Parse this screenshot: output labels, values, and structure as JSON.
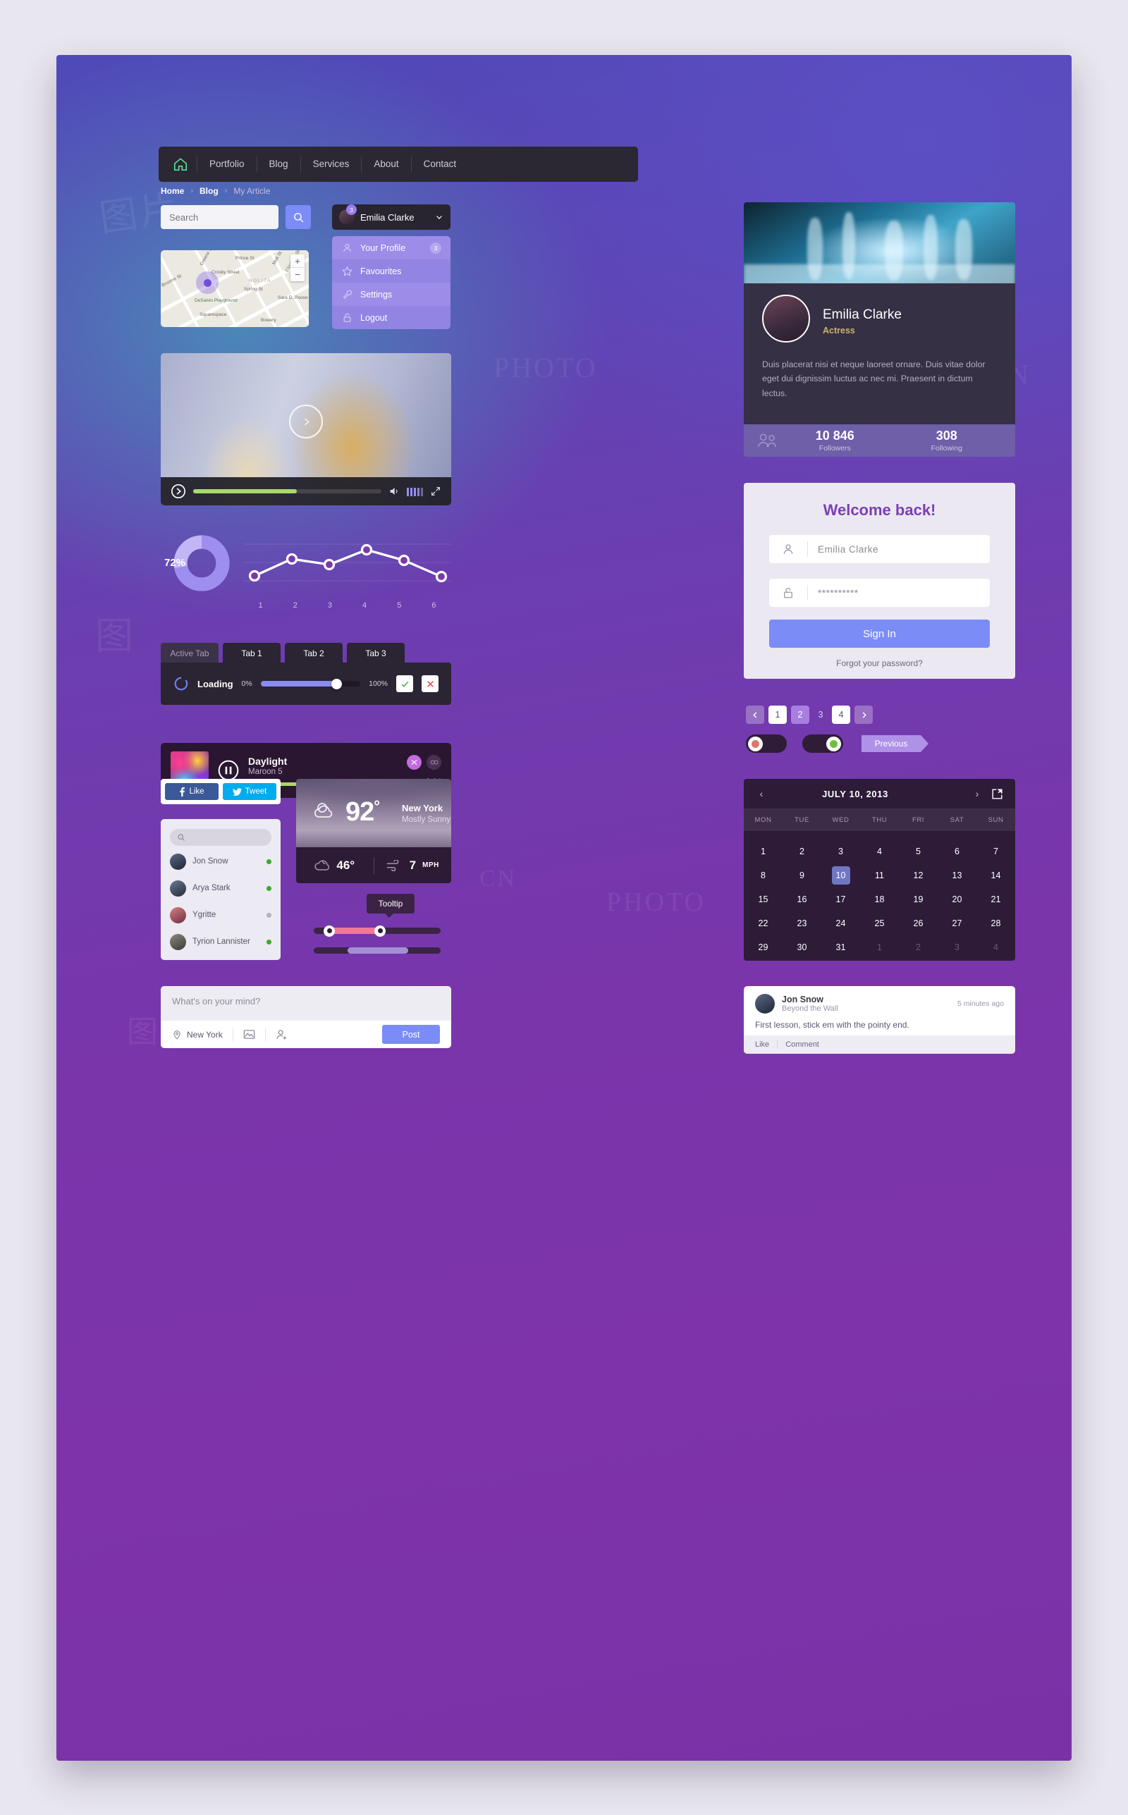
{
  "nav": {
    "home_icon": "home-icon",
    "items": [
      "Portfolio",
      "Blog",
      "Services",
      "About",
      "Contact"
    ]
  },
  "breadcrumb": {
    "items": [
      "Home",
      "Blog",
      "My Article"
    ],
    "separator": "›"
  },
  "search": {
    "placeholder": "Search",
    "value": "",
    "icon": "search-icon"
  },
  "user_pill": {
    "name": "Emilia Clarke",
    "badge": "3",
    "chevron": "chevron-down-icon"
  },
  "dropdown": {
    "items": [
      {
        "label": "Your Profile",
        "icon": "user-icon",
        "count": "3"
      },
      {
        "label": "Favourites",
        "icon": "star-icon",
        "count": ""
      },
      {
        "label": "Settings",
        "icon": "wrench-icon",
        "count": ""
      },
      {
        "label": "Logout",
        "icon": "lock-icon",
        "count": ""
      }
    ]
  },
  "map": {
    "labels": [
      "Prince St",
      "Crosby Street",
      "Greene St",
      "Broome St",
      "NOLITA",
      "Mott St",
      "Elizabeth St",
      "Spring St",
      "Sara D. Roose",
      "DeSalvio Playground",
      "Squarespace",
      "Bowery"
    ],
    "zoom_in": "+",
    "zoom_out": "−"
  },
  "video": {
    "play_icon": "play-icon",
    "progress_pct": 55,
    "volume_icon": "volume-icon",
    "fullscreen_icon": "expand-icon",
    "equalizer_bars": 5
  },
  "chart_data": [
    {
      "type": "pie",
      "title": "",
      "label": "72%",
      "values": [
        72,
        28
      ],
      "categories": [
        "complete",
        "remaining"
      ],
      "colors": [
        "#9d8ef0",
        "#c3b6f5"
      ]
    },
    {
      "type": "line",
      "title": "",
      "xlabel": "",
      "ylabel": "",
      "categories": [
        "1",
        "2",
        "3",
        "4",
        "5",
        "6"
      ],
      "x": [
        1,
        2,
        3,
        4,
        5,
        6
      ],
      "values": [
        28,
        62,
        52,
        76,
        60,
        30
      ],
      "ylim": [
        0,
        100
      ],
      "grid": true,
      "series": [
        {
          "name": "series-1",
          "values": [
            28,
            62,
            52,
            76,
            60,
            30
          ]
        }
      ],
      "legend": "none",
      "line_color": "#ffffff",
      "marker": "circle-open"
    }
  ],
  "tabs": {
    "items": [
      "Active Tab",
      "Tab 1",
      "Tab 2",
      "Tab 3"
    ],
    "active_index": 0,
    "panel": {
      "loading_label": "Loading",
      "min_label": "0%",
      "max_label": "100%",
      "value_pct": 76,
      "accept_icon": "check-icon",
      "reject_icon": "cross-icon"
    }
  },
  "music": {
    "title": "Daylight",
    "artist": "Maroon 5",
    "time": "2:04",
    "progress_pct": 62,
    "pause_icon": "pause-icon",
    "shuffle_icon": "shuffle-icon",
    "repeat_icon": "repeat-icon"
  },
  "profile": {
    "name": "Emilia Clarke",
    "role": "Actress",
    "bio": "Duis placerat nisi et neque laoreet ornare. Duis vitae dolor eget dui dignissim luctus ac nec mi. Praesent in dictum lectus.",
    "stats": [
      {
        "value": "10 846",
        "label": "Followers"
      },
      {
        "value": "308",
        "label": "Following"
      }
    ],
    "people_icon": "people-icon"
  },
  "login": {
    "title": "Welcome back!",
    "username_value": "Emilia Clarke",
    "username_icon": "user-icon",
    "password_value": "**********",
    "password_icon": "lock-icon",
    "button": "Sign In",
    "forgot": "Forgot your password?"
  },
  "pagination": {
    "prev_icon": "chevron-left-icon",
    "next_icon": "chevron-right-icon",
    "pages": [
      "1",
      "2",
      "3",
      "4"
    ],
    "active_page": "2"
  },
  "toggles": [
    {
      "state": "off",
      "dot_color": "#e0756e"
    },
    {
      "state": "on",
      "dot_color": "#6fbf3e"
    }
  ],
  "previous_button": "Previous",
  "social": {
    "facebook_label": "Like",
    "facebook_icon": "facebook-icon",
    "twitter_label": "Tweet",
    "twitter_icon": "twitter-icon"
  },
  "contacts": {
    "search_placeholder": "",
    "search_icon": "search-icon",
    "people": [
      {
        "name": "Jon Snow",
        "status": "online"
      },
      {
        "name": "Arya Stark",
        "status": "online"
      },
      {
        "name": "Ygritte",
        "status": "offline"
      },
      {
        "name": "Tyrion Lannister",
        "status": "online"
      }
    ],
    "online_color": "#3fa92a",
    "offline_color": "#b7b3bf"
  },
  "weather": {
    "temperature": "92",
    "degree_symbol": "°",
    "city": "New York",
    "condition": "Mostly Sunny",
    "condition_icon": "sun-cloud-icon",
    "low_temp": "46°",
    "low_icon": "night-cloud-icon",
    "wind_speed": "7",
    "wind_unit": "MPH",
    "wind_icon": "wind-icon"
  },
  "tooltip": {
    "text": "Tooltip"
  },
  "range_slider": {
    "from_pct": 12,
    "to_pct": 52,
    "fill_color": "#f0789a"
  },
  "progress_slider": {
    "start_pct": 27,
    "end_pct": 74,
    "fill_color": "#a68ed6"
  },
  "calendar": {
    "title": "JULY 10, 2013",
    "prev_icon": "chevron-left-icon",
    "next_icon": "chevron-right-icon",
    "edit_icon": "edit-icon",
    "weekdays": [
      "MON",
      "TUE",
      "WED",
      "THU",
      "FRI",
      "SAT",
      "SUN"
    ],
    "selected_day": "10",
    "days": [
      {
        "d": "1",
        "muted": false
      },
      {
        "d": "2",
        "muted": false
      },
      {
        "d": "3",
        "muted": false
      },
      {
        "d": "4",
        "muted": false
      },
      {
        "d": "5",
        "muted": false
      },
      {
        "d": "6",
        "muted": false
      },
      {
        "d": "7",
        "muted": false
      },
      {
        "d": "8",
        "muted": false
      },
      {
        "d": "9",
        "muted": false
      },
      {
        "d": "10",
        "muted": false
      },
      {
        "d": "11",
        "muted": false
      },
      {
        "d": "12",
        "muted": false
      },
      {
        "d": "13",
        "muted": false
      },
      {
        "d": "14",
        "muted": false
      },
      {
        "d": "15",
        "muted": false
      },
      {
        "d": "16",
        "muted": false
      },
      {
        "d": "17",
        "muted": false
      },
      {
        "d": "18",
        "muted": false
      },
      {
        "d": "19",
        "muted": false
      },
      {
        "d": "20",
        "muted": false
      },
      {
        "d": "21",
        "muted": false
      },
      {
        "d": "22",
        "muted": false
      },
      {
        "d": "23",
        "muted": false
      },
      {
        "d": "24",
        "muted": false
      },
      {
        "d": "25",
        "muted": false
      },
      {
        "d": "26",
        "muted": false
      },
      {
        "d": "27",
        "muted": false
      },
      {
        "d": "28",
        "muted": false
      },
      {
        "d": "29",
        "muted": false
      },
      {
        "d": "30",
        "muted": false
      },
      {
        "d": "31",
        "muted": false
      },
      {
        "d": "1",
        "muted": true
      },
      {
        "d": "2",
        "muted": true
      },
      {
        "d": "3",
        "muted": true
      },
      {
        "d": "4",
        "muted": true
      }
    ]
  },
  "composer": {
    "placeholder": "What's on your mind?",
    "location": "New York",
    "location_icon": "pin-icon",
    "photo_icon": "image-icon",
    "tag_icon": "user-add-icon",
    "post_button": "Post"
  },
  "comment": {
    "author": "Jon Snow",
    "subtitle": "Beyond the Wall",
    "time": "5 minutes ago",
    "text": "First lesson, stick em with the pointy end.",
    "like_label": "Like",
    "comment_label": "Comment"
  }
}
